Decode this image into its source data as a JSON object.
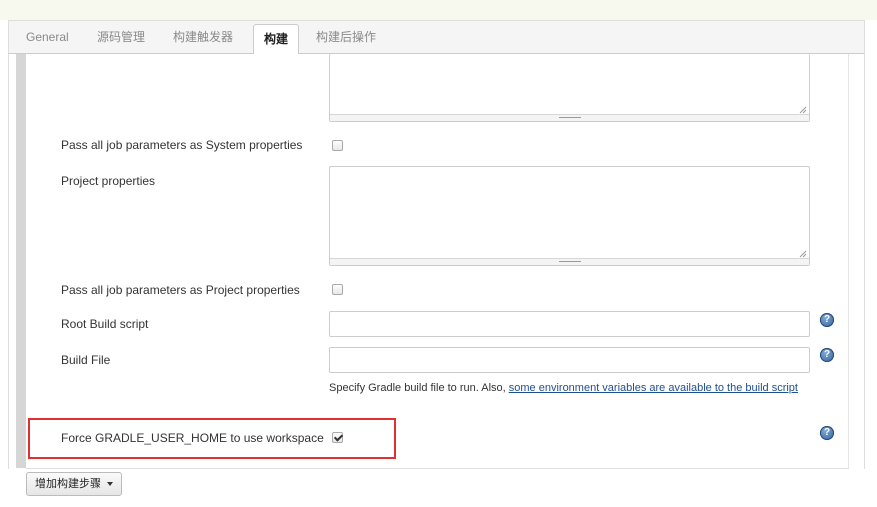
{
  "tabs": [
    {
      "label": "General"
    },
    {
      "label": "源码管理"
    },
    {
      "label": "构建触发器"
    },
    {
      "label": "构建",
      "active": true
    },
    {
      "label": "构建后操作"
    }
  ],
  "form": {
    "pass_system_props_label": "Pass all job parameters as System properties",
    "pass_system_props_checked": false,
    "project_properties_label": "Project properties",
    "project_properties_value": "",
    "pass_project_props_label": "Pass all job parameters as Project properties",
    "pass_project_props_checked": false,
    "root_build_script_label": "Root Build script",
    "root_build_script_value": "",
    "build_file_label": "Build File",
    "build_file_value": "",
    "build_file_desc_prefix": "Specify Gradle build file to run. Also, ",
    "build_file_desc_link": "some environment variables are available to the build script",
    "force_gradle_home_label": "Force GRADLE_USER_HOME to use workspace",
    "force_gradle_home_checked": true
  },
  "help_icon_glyph": "?",
  "add_step_button": "增加构建步骤",
  "colors": {
    "highlight": "#e03030",
    "link": "#1d4f91"
  }
}
